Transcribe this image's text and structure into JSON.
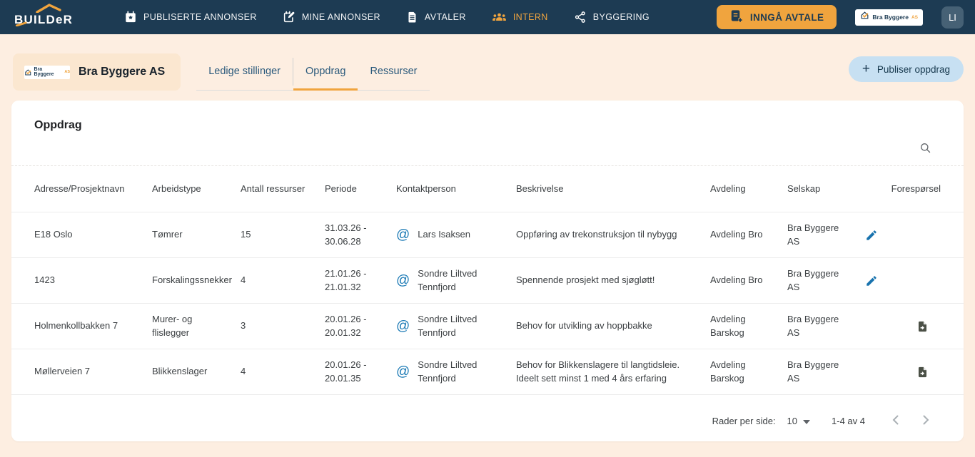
{
  "colors": {
    "navy": "#1d3b53",
    "orange": "#f0a43e",
    "link_blue": "#1878b4",
    "page_bg": "#fdeee1",
    "publish_btn_bg": "#c7e0f2"
  },
  "brand": {
    "logo_text": "BUILDeR",
    "logo_icon": "roof-icon"
  },
  "nav": {
    "items": [
      {
        "label": "PUBLISERTE ANNONSER",
        "icon": "calendar-star-icon",
        "active": false
      },
      {
        "label": "MINE ANNONSER",
        "icon": "calendar-edit-icon",
        "active": false
      },
      {
        "label": "AVTALER",
        "icon": "document-icon",
        "active": false
      },
      {
        "label": "INTERN",
        "icon": "people-icon",
        "active": true
      },
      {
        "label": "BYGGERING",
        "icon": "network-icon",
        "active": false
      }
    ],
    "cta": {
      "label": "INNGÅ AVTALE",
      "icon": "document-plus-icon"
    },
    "company_badge": {
      "name": "Bra Byggere",
      "suffix": "AS",
      "icon": "house-check-icon"
    },
    "avatar": {
      "initials": "LI"
    }
  },
  "subheader": {
    "company_logo": {
      "name": "Bra Byggere",
      "suffix": "AS",
      "icon": "house-check-icon"
    },
    "company_name": "Bra Byggere AS",
    "tabs": [
      {
        "label": "Ledige stillinger",
        "active": false
      },
      {
        "label": "Oppdrag",
        "active": true
      },
      {
        "label": "Ressurser",
        "active": false
      }
    ],
    "publish_button": {
      "label": "Publiser oppdrag",
      "icon": "plus-icon"
    }
  },
  "main": {
    "title": "Oppdrag",
    "search_icon": "search-icon",
    "columns": [
      "Adresse/Prosjektnavn",
      "Arbeidstype",
      "Antall ressurser",
      "Periode",
      "Kontaktperson",
      "Beskrivelse",
      "Avdeling",
      "Selskap",
      "Forespørsel"
    ],
    "rows": [
      {
        "adresse": "E18 Oslo",
        "arbeidstype": "Tømrer",
        "antall": "15",
        "periode": "31.03.26 -\n30.06.28",
        "kontakt": "Lars Isaksen",
        "kontakt_icon": "at-icon",
        "beskrivelse": "Oppføring av trekonstruksjon til nybygg",
        "avdeling": "Avdeling Bro",
        "selskap": "Bra Byggere AS",
        "action_icon": "edit-pencil-icon"
      },
      {
        "adresse": "1423",
        "arbeidstype": "Forskalingssnekker",
        "antall": "4",
        "periode": "21.01.26 -\n21.01.32",
        "kontakt": "Sondre Liltved Tennfjord",
        "kontakt_icon": "at-icon",
        "beskrivelse": "Spennende prosjekt med sjøgløtt!",
        "avdeling": "Avdeling Bro",
        "selskap": "Bra Byggere AS",
        "action_icon": "edit-pencil-icon"
      },
      {
        "adresse": "Holmenkollbakken 7",
        "arbeidstype": "Murer- og flislegger",
        "antall": "3",
        "periode": "20.01.26 -\n20.01.32",
        "kontakt": "Sondre Liltved Tennfjord",
        "kontakt_icon": "at-icon",
        "beskrivelse": "Behov for utvikling av hoppbakke",
        "avdeling": "Avdeling Barskog",
        "selskap": "Bra Byggere AS",
        "action_icon": "document-request-icon"
      },
      {
        "adresse": "Møllerveien 7",
        "arbeidstype": "Blikkenslager",
        "antall": "4",
        "periode": "20.01.26 -\n20.01.35",
        "kontakt": "Sondre Liltved Tennfjord",
        "kontakt_icon": "at-icon",
        "beskrivelse": "Behov for Blikkenslagere til langtidsleie. Ideelt sett minst 1 med 4 års erfaring",
        "avdeling": "Avdeling Barskog",
        "selskap": "Bra Byggere AS",
        "action_icon": "document-request-icon"
      }
    ],
    "pagination": {
      "rows_per_page_label": "Rader per side:",
      "rows_per_page_value": "10",
      "range": "1-4 av 4",
      "prev_icon": "chevron-left-icon",
      "next_icon": "chevron-right-icon"
    }
  }
}
